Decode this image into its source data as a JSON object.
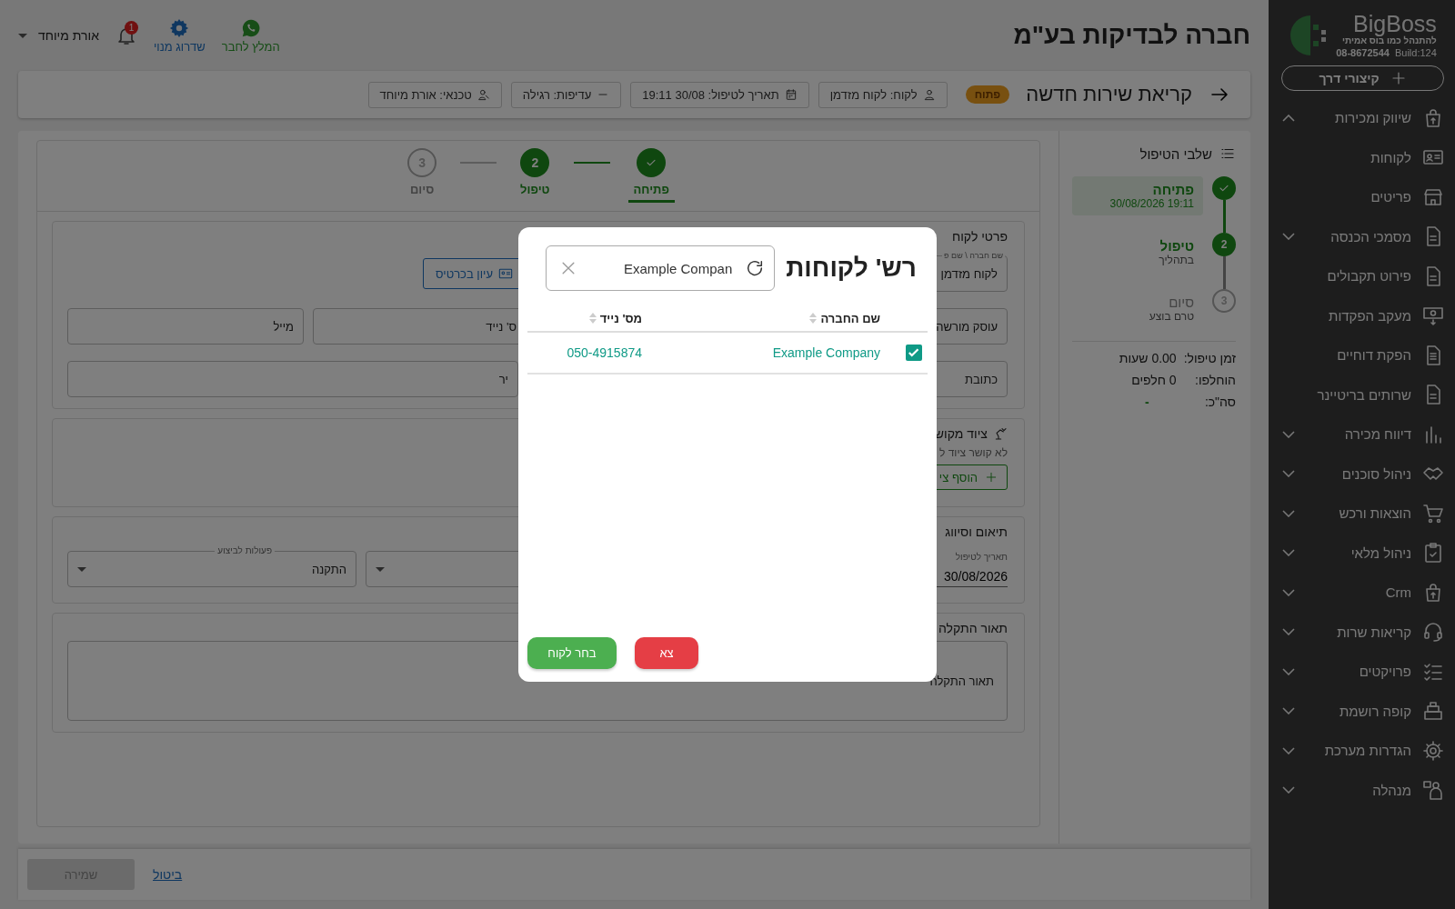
{
  "sidebar": {
    "brand": "BigBoss",
    "tagline": "להתנהל כמו בוס אמיתי",
    "phone": "08-8672544",
    "build": "Build:124",
    "shortcut_button": "קיצורי דרך",
    "menu": [
      {
        "label": "שיווק ומכירות",
        "kind": "group",
        "expanded": true,
        "children": [
          {
            "label": "לקוחות",
            "kind": "link"
          },
          {
            "label": "פריטים",
            "kind": "link"
          },
          {
            "label": "מסמכי הכנסה",
            "kind": "group",
            "expanded": false
          },
          {
            "label": "פירוט תקבולים",
            "kind": "link"
          },
          {
            "label": "מעקב הפקדות",
            "kind": "link"
          },
          {
            "label": "הפקת דוחיים",
            "kind": "link"
          },
          {
            "label": "שרותים בריטיינר",
            "kind": "link"
          },
          {
            "label": "דיווח מכירה",
            "kind": "group",
            "expanded": false
          }
        ]
      },
      {
        "label": "ניהול סוכנים",
        "kind": "group",
        "expanded": false
      },
      {
        "label": "הוצאות ורכש",
        "kind": "group",
        "expanded": false
      },
      {
        "label": "ניהול מלאי",
        "kind": "group",
        "expanded": false
      },
      {
        "label": "Crm",
        "kind": "group",
        "expanded": false
      },
      {
        "label": "קריאות שרות",
        "kind": "group",
        "expanded": false
      },
      {
        "label": "פרויקטים",
        "kind": "group",
        "expanded": false
      },
      {
        "label": "קופה רושמת",
        "kind": "group",
        "expanded": false
      },
      {
        "label": "הגדרות מערכת",
        "kind": "group",
        "expanded": false
      },
      {
        "label": "מנהלה",
        "kind": "group",
        "expanded": false
      }
    ]
  },
  "header": {
    "company_title": "חברה לבדיקות בע\"מ",
    "refer": "המלץ לחבר",
    "upgrade": "שדרוג מנוי",
    "notifications": "1",
    "user": "אורת מיוחד"
  },
  "page_bar": {
    "title": "קריאת שירות חדשה",
    "status": "פתוח",
    "chips": [
      "לקוח: לקוח מזדמן",
      "תאריך לטיפול: 30/08 19:11",
      "עדיפות: רגילה",
      "טכנאי: אורת מיוחד"
    ]
  },
  "stages_panel": {
    "title": "שלבי הטיפול",
    "stages": [
      {
        "title": "פתיחה",
        "subtitle": "19:11 30/08/2026",
        "kind": "done",
        "selected": true
      },
      {
        "title": "טיפול",
        "subtitle": "בתהליך",
        "number": "2",
        "kind": "current",
        "selected": false
      },
      {
        "title": "סיום",
        "subtitle": "טרם בוצע",
        "number": "3",
        "kind": "pending",
        "selected": false
      }
    ],
    "stats": [
      {
        "label": "זמן טיפול:",
        "value": "0.00 שעות",
        "kind": "text"
      },
      {
        "label": "הוחלפו:",
        "value": "0 חלפים",
        "kind": "text"
      },
      {
        "label": "סה\"כ:",
        "value": "-",
        "kind": "total"
      }
    ]
  },
  "stepper": [
    {
      "label": "פתיחה",
      "kind": "done",
      "selected": true
    },
    {
      "label": "טיפול",
      "number": "2",
      "kind": "current",
      "selected": false
    },
    {
      "label": "סיום",
      "number": "3",
      "kind": "pending",
      "selected": false
    }
  ],
  "customer_section": {
    "title": "פרטי לקוח",
    "name_field": {
      "label": "שם חברה \\ שם פ",
      "value": "לקוח מזדמן"
    },
    "card_button": "עיון בכרטיס",
    "fields": [
      {
        "value": "עוסק מורשה"
      },
      {
        "value": "ס' נייד"
      },
      {
        "value": "מייל"
      }
    ],
    "address_fields": [
      {
        "value": "כתובת"
      },
      {
        "value": "יר"
      }
    ]
  },
  "equipment_section": {
    "title": "ציוד מקוש",
    "empty_text": "לא קושר ציוד ל",
    "add_button": "הוסף צי"
  },
  "schedule_section": {
    "title": "תיאום וסיווג",
    "date_field": {
      "label": "תאריך לטיפול",
      "value": "30/08/2026"
    },
    "actions_select": {
      "label": "פעולות לביצוע",
      "value": "התקנה"
    }
  },
  "description_section": {
    "title": "תאור התקלה",
    "value": "תאור התקלה"
  },
  "footer": {
    "save_button": {
      "label": "שמירה",
      "disabled": true
    },
    "cancel_link": "ביטול"
  },
  "modal": {
    "title": "רש' לקוחות",
    "search": {
      "value": "Example Compan"
    },
    "columns": [
      "שם החברה",
      "מס' נייד"
    ],
    "rows": [
      {
        "company": "Example Company",
        "mobile": "050-4915874",
        "checked": true
      }
    ],
    "buttons": [
      {
        "label": "צא",
        "kind": "cancel"
      },
      {
        "label": "בחר לקוח",
        "kind": "confirm"
      }
    ]
  }
}
